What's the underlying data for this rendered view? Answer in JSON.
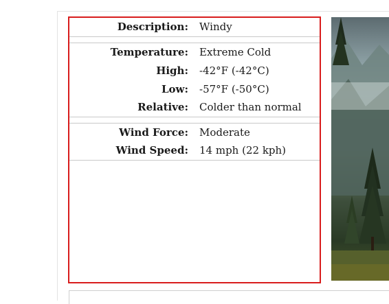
{
  "weather": {
    "rows": [
      {
        "label": "Description:",
        "value": "Windy"
      },
      {
        "label": "Temperature:",
        "value": "Extreme Cold"
      },
      {
        "label": "High:",
        "value": "-42°F (-42°C)"
      },
      {
        "label": "Low:",
        "value": "-57°F (-50°C)"
      },
      {
        "label": "Relative:",
        "value": "Colder than normal"
      },
      {
        "label": "Wind Force:",
        "value": "Moderate"
      },
      {
        "label": "Wind Speed:",
        "value": "14 mph (22 kph)"
      }
    ]
  },
  "colors": {
    "highlight_border": "#d81b1b",
    "divider": "#c8c8c8"
  },
  "photo": {
    "subject": "misty mountain forest landscape"
  }
}
